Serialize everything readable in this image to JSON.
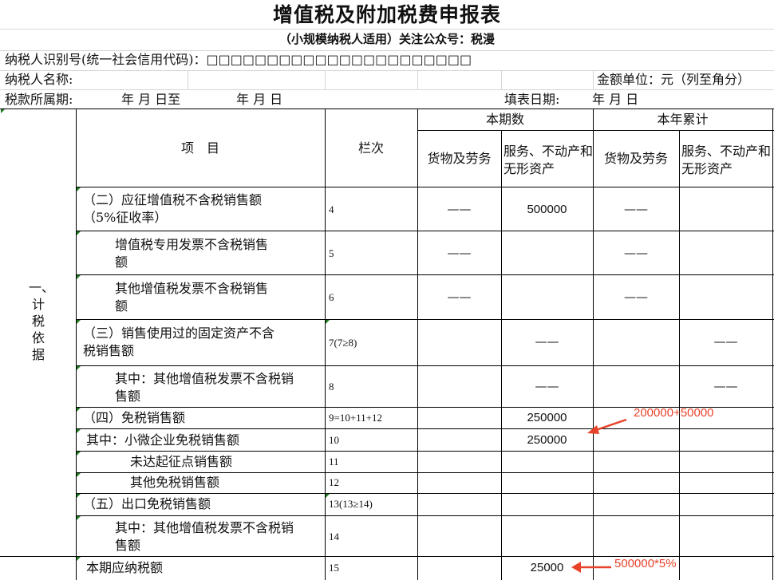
{
  "title": "增值税及附加税费申报表",
  "subtitle": "（小规模纳税人适用）关注公众号：税漫",
  "meta": {
    "taxpayer_id_label": "纳税人识别号(统一社会信用代码)：□□□□□□□□□□□□□□□□□□□□□□",
    "taxpayer_name_label": "纳税人名称:",
    "unit_label": "金额单位：元（列至角分）",
    "period_label": "税款所属期:",
    "period_value": "年  月  日至",
    "period_value2": "年  月  日",
    "fill_date_label": "填表日期:",
    "fill_date_value": "年  月  日"
  },
  "header": {
    "item": "项　目",
    "lane": "栏次",
    "current_period": "本期数",
    "year_total": "本年累计",
    "goods_services": "货物及劳务",
    "services_realestate": "服务、不动产和无形资产",
    "goods_services_2": "货物及劳务",
    "services_realestate_2": "服务、不动产和无形资产"
  },
  "section_label": "一、计税依据",
  "rows": [
    {
      "item": "（二）应征增值税不含税销售额（5%征收率）",
      "lane": "4",
      "c1": "——",
      "c2": "500000",
      "c3": "——",
      "c4": ""
    },
    {
      "item": "增值税专用发票不含税销售额",
      "lane": "5",
      "c1": "——",
      "c2": "",
      "c3": "——",
      "c4": ""
    },
    {
      "item": "其他增值税发票不含税销售额",
      "lane": "6",
      "c1": "——",
      "c2": "",
      "c3": "——",
      "c4": ""
    },
    {
      "item": "（三）销售使用过的固定资产不含税销售额",
      "lane": "7(7≥8)",
      "c1": "",
      "c2": "——",
      "c3": "",
      "c4": "——"
    },
    {
      "item": "其中：其他增值税发票不含税销售额",
      "lane": "8",
      "c1": "",
      "c2": "——",
      "c3": "",
      "c4": "——"
    },
    {
      "item": "（四）免税销售额",
      "lane": "9=10+11+12",
      "c1": "",
      "c2": "250000",
      "c3": "",
      "c4": ""
    },
    {
      "item": "其中：小微企业免税销售额",
      "lane": "10",
      "c1": "",
      "c2": "250000",
      "c3": "",
      "c4": ""
    },
    {
      "item": "未达起征点销售额",
      "lane": "11",
      "c1": "",
      "c2": "",
      "c3": "",
      "c4": ""
    },
    {
      "item": "其他免税销售额",
      "lane": "12",
      "c1": "",
      "c2": "",
      "c3": "",
      "c4": ""
    },
    {
      "item": "（五）出口免税销售额",
      "lane": "13(13≥14)",
      "c1": "",
      "c2": "",
      "c3": "",
      "c4": ""
    },
    {
      "item": "其中：其他增值税发票不含税销售额",
      "lane": "14",
      "c1": "",
      "c2": "",
      "c3": "",
      "c4": ""
    },
    {
      "item": "本期应纳税额",
      "lane": "15",
      "c1": "",
      "c2": "25000",
      "c3": "",
      "c4": ""
    }
  ],
  "annotations": {
    "note1": "200000+50000",
    "note2": "500000*5%",
    "arrow_color": "#e8432a"
  }
}
